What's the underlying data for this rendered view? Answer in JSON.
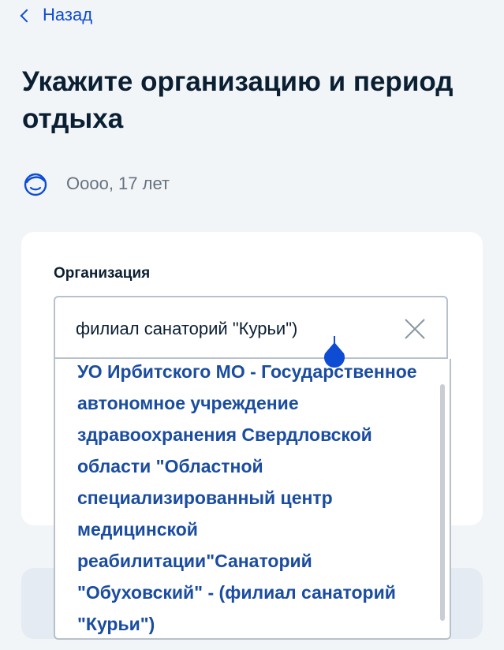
{
  "back": {
    "label": "Назад"
  },
  "page": {
    "title": "Укажите организацию и период отдыха"
  },
  "person": {
    "name": "Оооо, 17 лет",
    "icon": "child-face-icon"
  },
  "organization_field": {
    "label": "Организация",
    "value": "филиал санаторий \"Курьи\")",
    "clear_icon": "close-icon"
  },
  "dropdown": {
    "options": [
      {
        "label": "УО Ирбитского МО - Государственное автономное учреждение здравоохранения Свердловской области \"Областной специализированный центр медицинской реабилитации\"Санаторий \"Обуховский\" - (филиал санаторий \"Курьи\")"
      }
    ]
  },
  "colors": {
    "accent": "#0d4cd3",
    "option_text": "#1a4c9f",
    "title_text": "#0b1f33",
    "secondary_text": "#66727f",
    "background": "#f2f5f8"
  }
}
